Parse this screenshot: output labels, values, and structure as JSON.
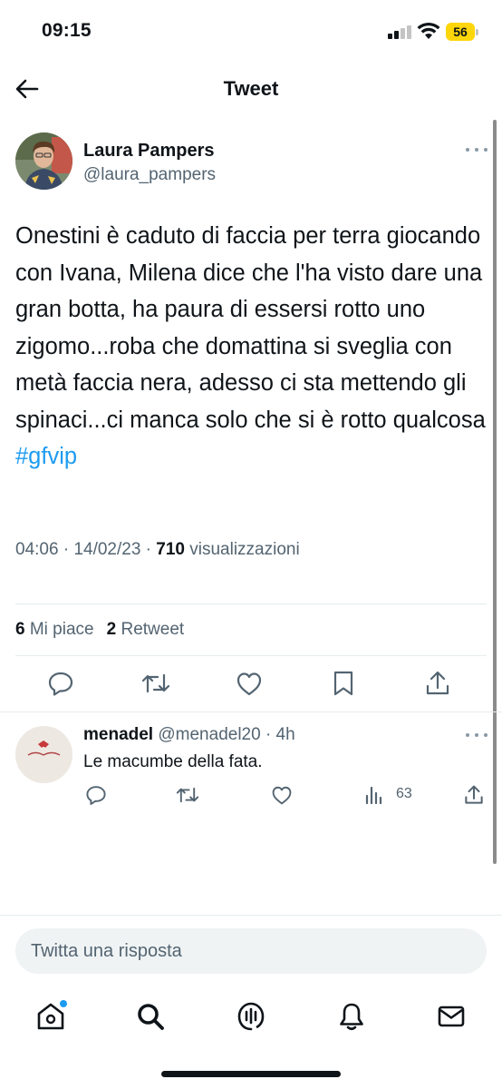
{
  "status_bar": {
    "time": "09:15",
    "battery": "56",
    "battery_color": "#ffd60a"
  },
  "header": {
    "back_icon": "arrow-left-icon",
    "title": "Tweet"
  },
  "tweet": {
    "author_name": "Laura Pampers",
    "author_handle": "@laura_pampers",
    "text": "Onestini è caduto di faccia per terra giocando con Ivana, Milena dice che l'ha visto dare una gran botta, ha paura di essersi rotto uno zigomo...roba che domattina si sveglia con metà faccia nera, adesso ci sta mettendo gli spinaci...ci manca solo che si è rotto qualcosa ",
    "hashtag": "#gfvip",
    "time_date": "04:06 · 14/02/23 · ",
    "views": "710",
    "views_label": " visualizzazioni",
    "likes_count": "6",
    "likes_label": " Mi piace",
    "retweets_count": "2",
    "retweets_label": " Retweet",
    "actions": [
      "reply-icon",
      "retweet-icon",
      "like-icon",
      "bookmark-icon",
      "share-icon"
    ]
  },
  "reply": {
    "author_name": "menadel",
    "author_handle": " @menadel20 · 4h",
    "text": "Le macumbe della fata.",
    "views": "63",
    "actions": [
      "reply-icon",
      "retweet-icon",
      "like-icon",
      "views-icon",
      "share-icon"
    ]
  },
  "compose": {
    "placeholder": "Twitta una risposta"
  },
  "tab_bar": {
    "tabs": [
      "home-icon",
      "search-icon",
      "spaces-icon",
      "notifications-icon",
      "messages-icon"
    ]
  },
  "colors": {
    "accent": "#1d9bf0",
    "text_primary": "#0f1419",
    "text_secondary": "#536471"
  }
}
